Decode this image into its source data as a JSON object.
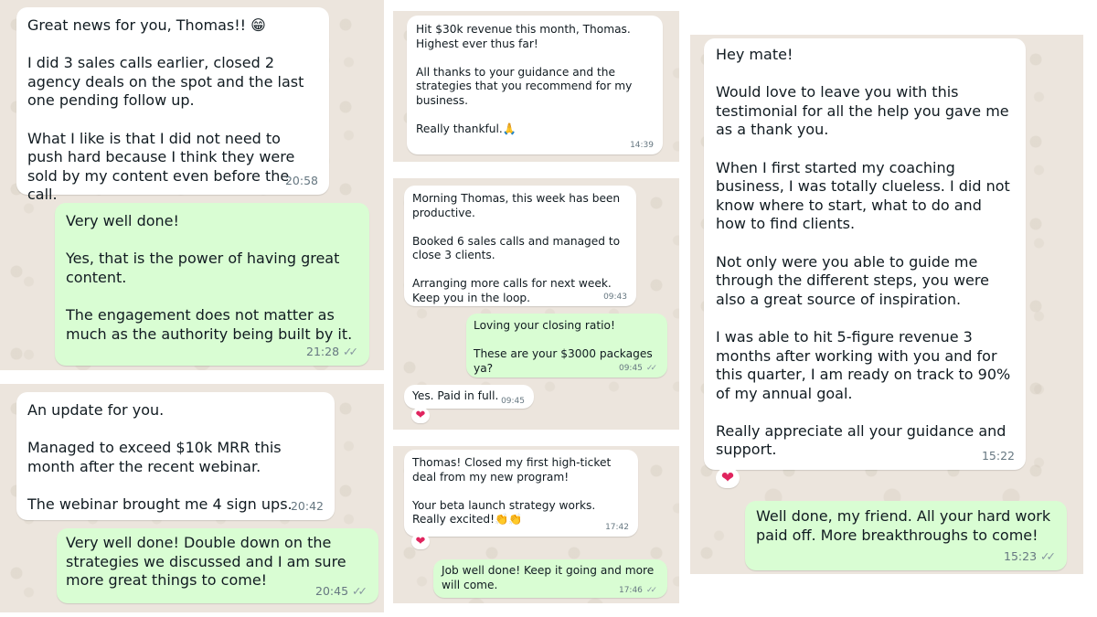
{
  "screenshots": [
    {
      "messages": [
        {
          "text": "Great news for you, Thomas!! 😁\n\nI did 3 sales calls earlier, closed 2 agency deals on the spot and the last one pending follow up.\n\nWhat I like is that I did not need to push hard because I think they were sold by my content even before the call.",
          "time": "20:58"
        },
        {
          "text": "Very well done!\n\nYes, that is the power of having great content.\n\nThe engagement does not matter as much as the authority being built by it.",
          "time": "21:28"
        }
      ]
    },
    {
      "messages": [
        {
          "text": "An update for you.\n\nManaged to exceed $10k MRR this month after the recent webinar.\n\nThe webinar brought me 4 sign ups.",
          "time": "20:42"
        },
        {
          "text": "Very well done! Double down on the strategies we discussed and I am sure more great things to come!",
          "time": "20:45"
        }
      ]
    },
    {
      "messages": [
        {
          "text": "Hit $30k revenue this month, Thomas.\nHighest ever thus far!\n\nAll thanks to your guidance and the strategies that you recommend for my business.\n\nReally thankful.🙏",
          "time": "14:39"
        }
      ]
    },
    {
      "messages": [
        {
          "text": "Morning Thomas, this week has been productive.\n\nBooked 6 sales calls and managed to close 3 clients.\n\nArranging more calls for next week. Keep you in the loop.",
          "time": "09:43"
        },
        {
          "text": "Loving your closing ratio!\n\nThese are your $3000 packages ya?",
          "time": "09:45"
        },
        {
          "text": "Yes. Paid in full.",
          "time": "09:45"
        }
      ]
    },
    {
      "messages": [
        {
          "text": "Thomas! Closed my first high-ticket deal from my new program!\n\nYour beta launch strategy works. Really excited!👏👏",
          "time": "17:42"
        },
        {
          "text": "Job well done! Keep it going and more will come.",
          "time": "17:46"
        }
      ]
    },
    {
      "messages": [
        {
          "text": "Hey mate!\n\nWould love to leave you with this testimonial for all the help you gave me as a thank you.\n\nWhen I first started my coaching business, I was totally clueless. I did not know where to start, what to do and how to find clients.\n\nNot only were you able to guide me through the different steps, you were also a great source of inspiration.\n\nI was able to hit 5-figure revenue 3 months after working with you and for this quarter, I am ready on track to 90% of my annual goal.\n\nReally appreciate all your guidance and support.",
          "time": "15:22"
        },
        {
          "text": "Well done, my friend. All your hard work paid off. More breakthroughs to come!",
          "time": "15:23"
        }
      ]
    }
  ],
  "reaction_icon": "heart-icon",
  "read_receipt_icon": "double-check-icon",
  "colors": {
    "incoming_bubble": "#ffffff",
    "outgoing_bubble": "#d9fdd3",
    "chat_background": "#ece5dd",
    "heart": "#e0245e",
    "timestamp": "#667781"
  }
}
